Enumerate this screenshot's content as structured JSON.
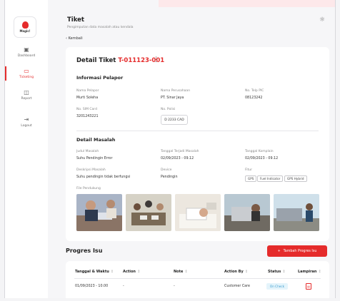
{
  "sidebar": {
    "logo_text": "Magic!",
    "items": [
      {
        "label": "Dashboard",
        "icon": "dashboard-icon"
      },
      {
        "label": "Ticketing",
        "icon": "ticket-icon",
        "active": true
      },
      {
        "label": "Report",
        "icon": "report-icon"
      },
      {
        "label": "Logout",
        "icon": "logout-icon"
      }
    ]
  },
  "header": {
    "title": "Tiket",
    "subtitle": "Pengimputan data masalah atau kendala",
    "back": "Kembali"
  },
  "detail": {
    "title_prefix": "Detail Tiket ",
    "ticket_id": "T-011123-001",
    "pelapor": {
      "section": "Informasi Pelapor",
      "nama_pelapor_label": "Nama Pelapor",
      "nama_pelapor": "Murti Soleha",
      "nama_perusahaan_label": "Nama Perusahaan",
      "nama_perusahaan": "PT. Sinar Jaya",
      "telp_label": "No. Telp PIC",
      "telp": "08123242",
      "sim_label": "No. SIM Card",
      "sim": "3201243221",
      "polisi_label": "No. Polisi",
      "polisi": "D 2233 CAD"
    },
    "masalah": {
      "section": "Detail Masalah",
      "judul_label": "Judul Masalah",
      "judul": "Suhu Pendingin Error",
      "tgl_masalah_label": "Tanggal Terjadi Masalah",
      "tgl_masalah": "02/09/2023 - 09.12",
      "tgl_komplain_label": "Tanggal Komplain",
      "tgl_komplain": "02/09/2023 - 09.12",
      "deskripsi_label": "Deskripsi Masalah",
      "deskripsi": "Suhu pendingin tidak berfungsi",
      "device_label": "Device",
      "device": "Pendingin",
      "fitur_label": "Fitur",
      "fitur": [
        "GPS",
        "Fuel Indicator",
        "GPS Hybrid"
      ],
      "file_label": "File Pendukung"
    }
  },
  "progress": {
    "title": "Progres Isu",
    "add_button": "Tambah Progres Isu",
    "columns": [
      "Tanggal & Waktu",
      "Action",
      "Note",
      "Action By",
      "Status",
      "Lampiran"
    ],
    "rows": [
      {
        "tanggal": "01/09/2023 - 10.00",
        "action": "-",
        "note": "-",
        "action_by": "Customer Care",
        "status": "On Check"
      }
    ]
  },
  "colors": {
    "accent": "#e52b2b",
    "status": "#3b9ccf"
  }
}
